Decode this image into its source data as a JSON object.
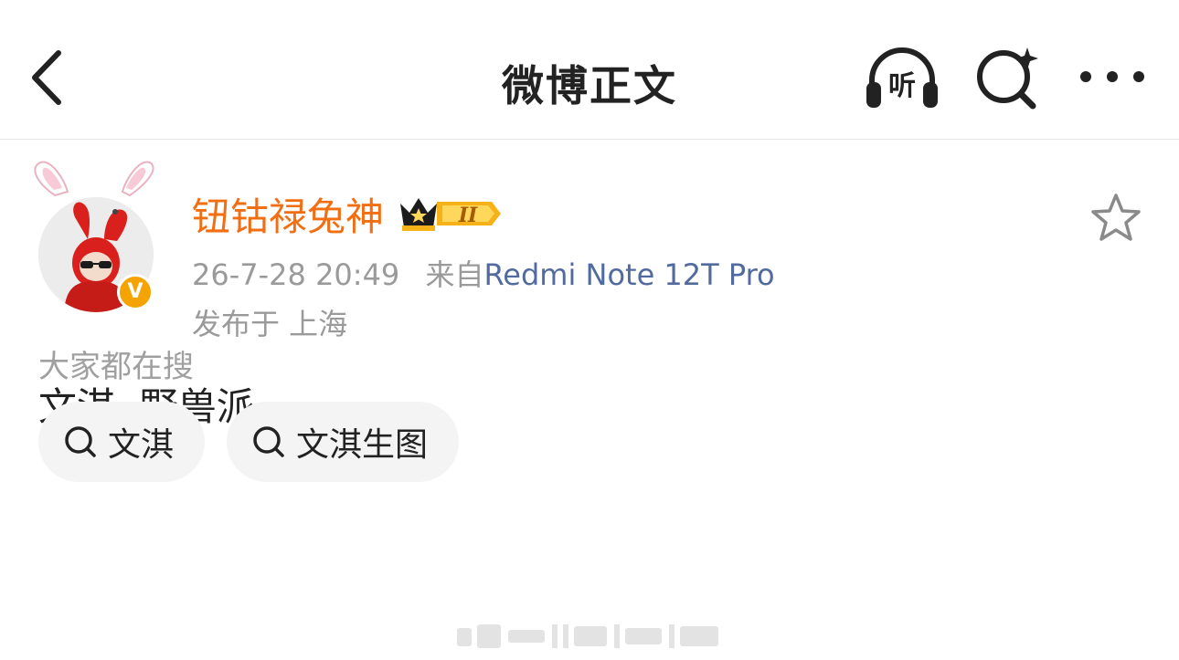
{
  "header": {
    "title": "微博正文",
    "listen_label": "听"
  },
  "post": {
    "username": "钮钴禄兔神",
    "vip_level": "II",
    "timestamp": "26-7-28 20:49",
    "source_prefix": "来自",
    "device": "Redmi Note 12T Pro",
    "location": "发布于 上海",
    "content": "文淇  野兽派",
    "verified_mark": "V"
  },
  "related": {
    "title": "大家都在搜",
    "chips": [
      "文淇",
      "文淇生图"
    ]
  },
  "colors": {
    "username": "#f26e12",
    "device_link": "#526b9e",
    "verified_badge": "#f5a300",
    "chip_bg": "#f4f4f4"
  },
  "icons": [
    "chevron-left-icon",
    "headphones-icon",
    "search-sparkle-icon",
    "more-icon",
    "star-icon",
    "crown-icon",
    "search-icon"
  ]
}
